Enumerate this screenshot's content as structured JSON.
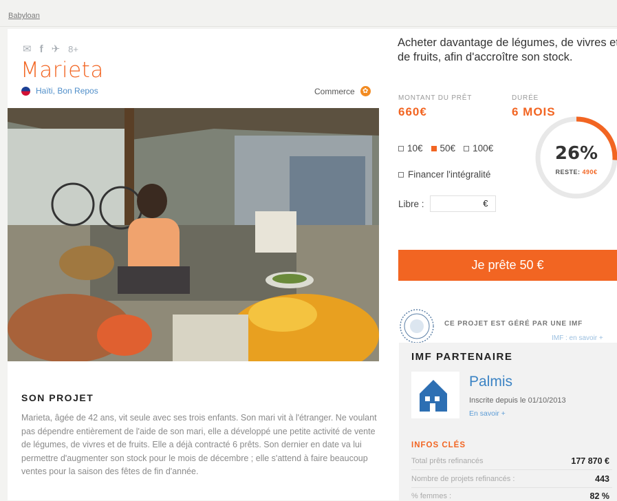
{
  "breadcrumb": "Babyloan",
  "social": {
    "mail": "✉",
    "facebook": "f",
    "twitter": "✈",
    "google": "8+"
  },
  "borrower": {
    "name": "Marieta",
    "location": "Haïti, Bon Repos",
    "category": "Commerce"
  },
  "project": {
    "section_title": "SON PROJET",
    "description": "Marieta, âgée de 42 ans, vit seule avec ses trois enfants. Son mari vit à l'étranger. Ne voulant pas dépendre entièrement de l'aide de son mari, elle a développé une petite activité de vente de légumes, de vivres et de fruits. Elle a déjà contracté 6 prêts. Son dernier en date va lui permettre d'augmenter son stock pour le mois de décembre ; elle s'attend à faire beaucoup ventes pour la saison des fêtes de fin d'année.",
    "title": "Acheter davantage de légumes, de vivres et de fruits, afin d'accroître son stock."
  },
  "loan": {
    "amount_label": "MONTANT DU PRÊT",
    "amount": "660€",
    "duration_label": "DURÉE",
    "duration": "6 MOIS",
    "options": [
      {
        "label": "10€",
        "selected": false
      },
      {
        "label": "50€",
        "selected": true
      },
      {
        "label": "100€",
        "selected": false
      }
    ],
    "full_label": "Financer l'intégralité",
    "libre_label": "Libre :",
    "libre_currency": "€",
    "progress_percent": 26,
    "progress_text": "26%",
    "remaining_label": "RESTE:",
    "remaining_value": "490€",
    "cta": "Je prête 50 €"
  },
  "imf": {
    "caption": "CE PROJET EST GÉRÉ PAR UNE IMF",
    "link": "IMF : en savoir +",
    "section_title": "IMF PARTENAIRE",
    "name": "Palmis",
    "since": "Inscrite depuis le 01/10/2013",
    "more": "En savoir +",
    "infos_title": "INFOS CLÉS",
    "rows": [
      {
        "label": "Total prêts refinancés",
        "value": "177 870 €"
      },
      {
        "label": "Nombre de projets refinancés :",
        "value": "443"
      },
      {
        "label": "% femmes :",
        "value": "82 %"
      }
    ]
  },
  "colors": {
    "accent": "#f26522",
    "link": "#3b83c4"
  }
}
